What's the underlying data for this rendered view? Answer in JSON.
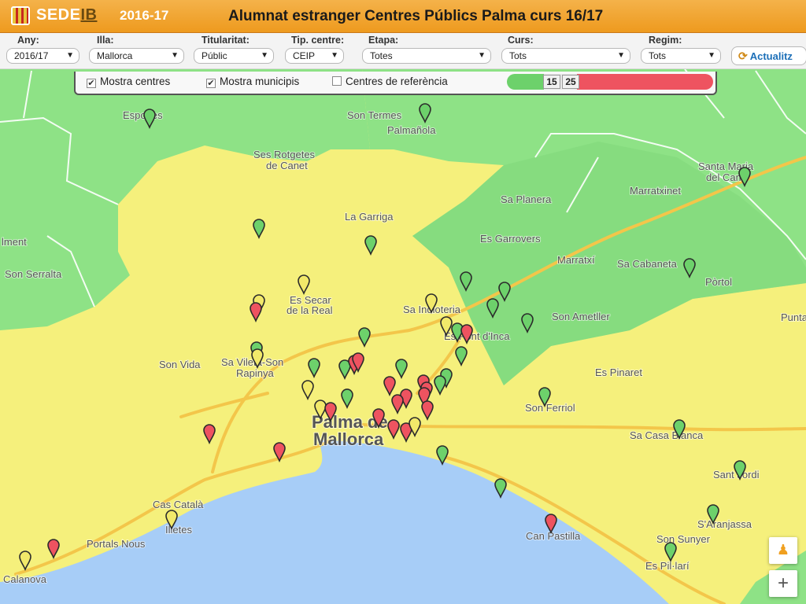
{
  "header": {
    "logo_main": "SEDE",
    "logo_accent": "IB",
    "year": "2016-17",
    "title": "Alumnat estranger Centres Públics Palma curs 16/17"
  },
  "filters": [
    {
      "label": "Any:",
      "value": "2016/17"
    },
    {
      "label": "Illa:",
      "value": "Mallorca"
    },
    {
      "label": "Titularitat:",
      "value": "Públic"
    },
    {
      "label": "Tip. centre:",
      "value": "CEIP"
    },
    {
      "label": "Etapa:",
      "value": "Totes"
    },
    {
      "label": "Curs:",
      "value": "Tots"
    },
    {
      "label": "Regim:",
      "value": "Tots"
    }
  ],
  "refresh_label": "Actualitz",
  "controls": {
    "show_centres": "Mostra centres",
    "show_municipalities": "Mostra municipis",
    "reference_centres": "Centres de referència",
    "show_centres_checked": true,
    "show_municipalities_checked": true,
    "reference_centres_checked": false
  },
  "legend": {
    "low_threshold": "15",
    "high_threshold": "25",
    "colors": {
      "low": "#6dd16b",
      "mid": "#f2e96a",
      "high": "#ee5360"
    }
  },
  "map": {
    "colors": {
      "green_zone": "#8ee286",
      "yellow_zone": "#f5f07c",
      "sea": "#a7cdf7",
      "road": "#f3c64a"
    },
    "places": [
      "Esporles",
      "Son Termes",
      "Palmañola",
      "Ses Rotgetes de Canet",
      "Santa Maria del Camí",
      "Marratxinet",
      "La Garriga",
      "Sa Planera",
      "Es Garrovers",
      "Marratxí",
      "Sa Cabaneta",
      "Pòrtol",
      "Son Serralta",
      "Es Secar de la Real",
      "Sa Indioteria",
      "Son Ametller",
      "Es Pont d'Inca",
      "Son Vida",
      "Sa Vileta-Son Rapinya",
      "Es Pinaret",
      "Son Ferriol",
      "Palma de Mallorca",
      "Sa Casa Blanca",
      "Sant Jordi",
      "Cas Català",
      "Illetes",
      "Portals Nous",
      "S'Aranjassa",
      "Son Sunyer",
      "Can Pastilla",
      "Es Pil·larí",
      "Punta",
      "lment",
      "Calanova"
    ],
    "markers_green": 33,
    "markers_yellow": 14,
    "markers_red": 22
  },
  "map_controls": {
    "zoom_in": "+",
    "pegman": "♟"
  }
}
